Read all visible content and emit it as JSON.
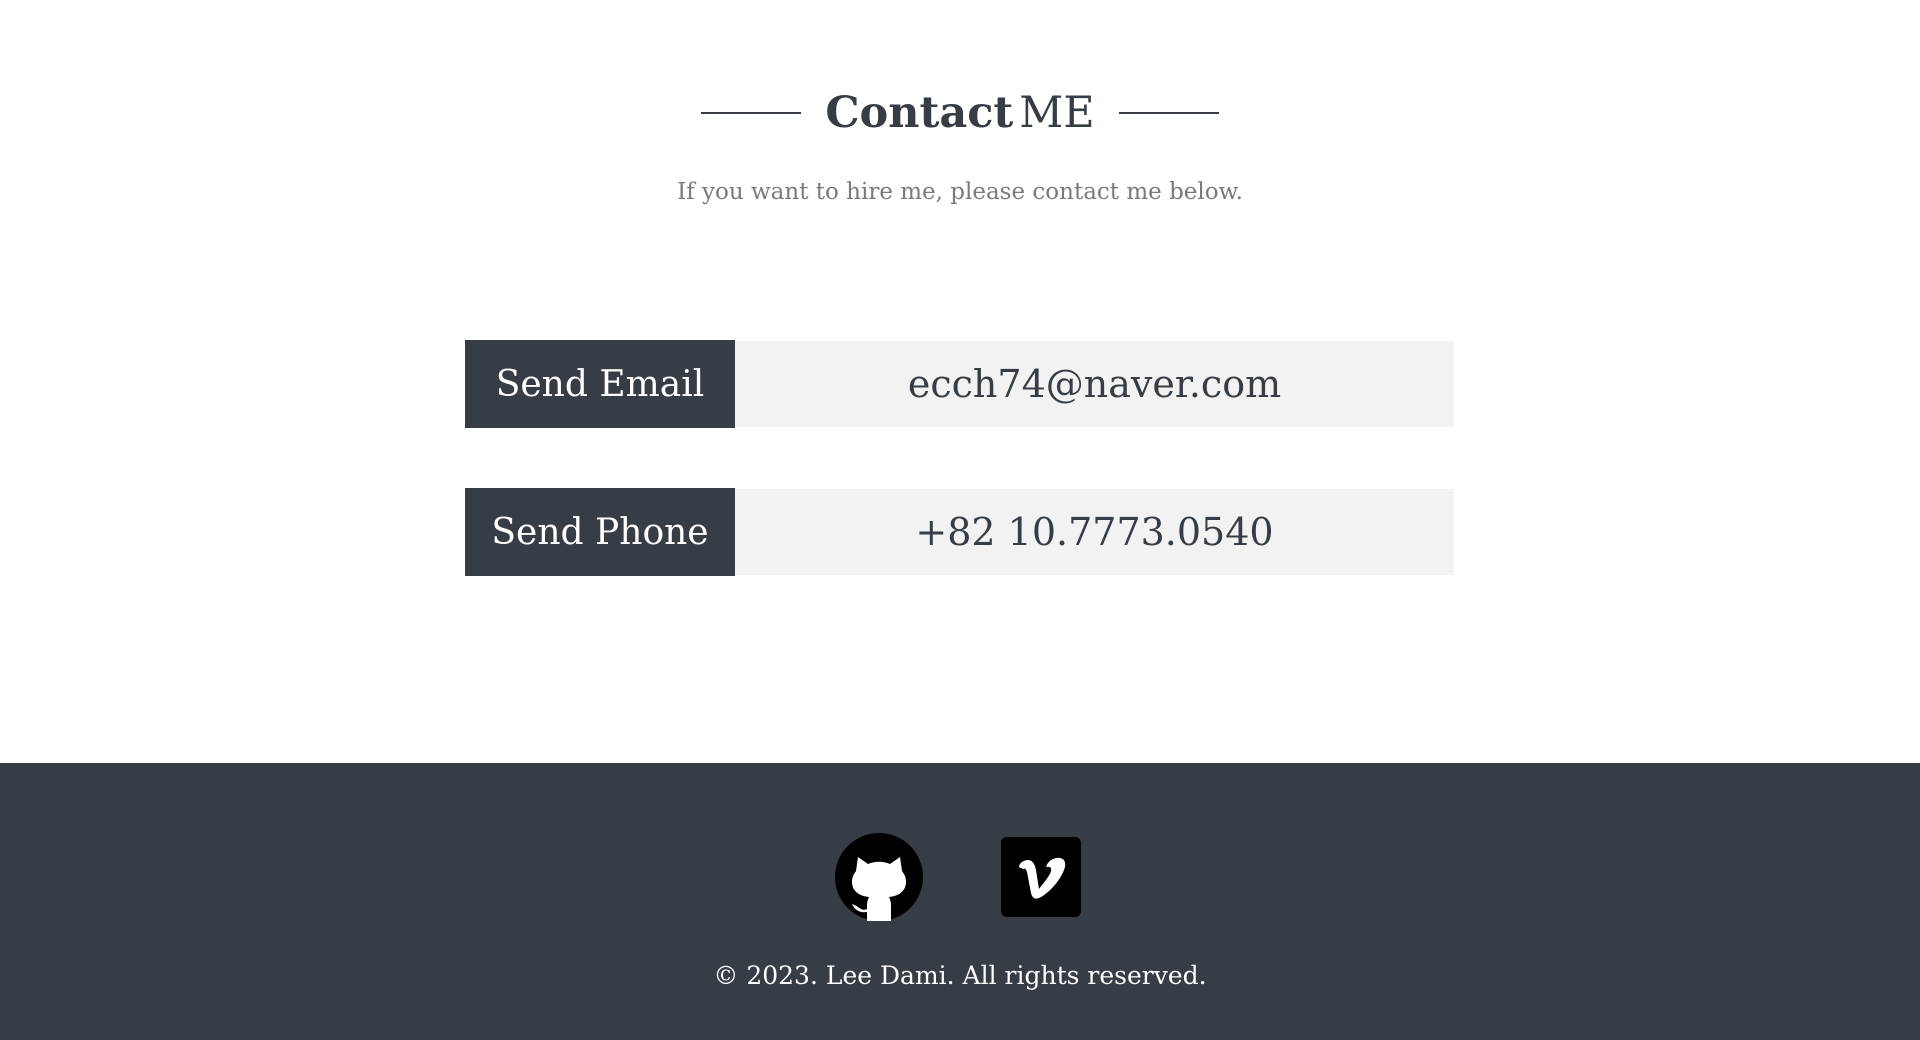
{
  "contact": {
    "title_bold": "Contact",
    "title_light": "ME",
    "subtitle": "If you want to hire me, please contact me below.",
    "email_button": "Send Email",
    "email_value": "ecch74@naver.com",
    "phone_button": "Send Phone",
    "phone_value": "+82 10.7773.0540"
  },
  "footer": {
    "social": [
      {
        "icon": "github-icon"
      },
      {
        "icon": "vimeo-icon"
      }
    ],
    "copyright": "© 2023. Lee Dami. All rights reserved."
  },
  "colors": {
    "dark": "#363d45",
    "value_bg": "#f2f2f2",
    "subtitle": "#7a7a7a"
  }
}
